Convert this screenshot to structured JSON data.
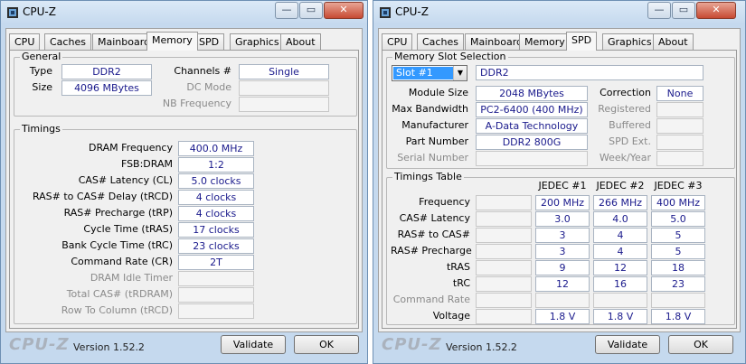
{
  "left_window": {
    "title": "CPU-Z",
    "tabs": [
      "CPU",
      "Caches",
      "Mainboard",
      "Memory",
      "SPD",
      "Graphics",
      "About"
    ],
    "active_tab": "Memory",
    "general": {
      "title": "General",
      "type_label": "Type",
      "type_value": "DDR2",
      "size_label": "Size",
      "size_value": "4096 MBytes",
      "channels_label": "Channels #",
      "channels_value": "Single",
      "dc_mode_label": "DC Mode",
      "nb_frequency_label": "NB Frequency"
    },
    "timings": {
      "title": "Timings",
      "rows": [
        {
          "label": "DRAM Frequency",
          "value": "400.0 MHz"
        },
        {
          "label": "FSB:DRAM",
          "value": "1:2"
        },
        {
          "label": "CAS# Latency (CL)",
          "value": "5.0 clocks"
        },
        {
          "label": "RAS# to CAS# Delay (tRCD)",
          "value": "4 clocks"
        },
        {
          "label": "RAS# Precharge (tRP)",
          "value": "4 clocks"
        },
        {
          "label": "Cycle Time (tRAS)",
          "value": "17 clocks"
        },
        {
          "label": "Bank Cycle Time (tRC)",
          "value": "23 clocks"
        },
        {
          "label": "Command Rate (CR)",
          "value": "2T"
        },
        {
          "label": "DRAM Idle Timer",
          "value": ""
        },
        {
          "label": "Total CAS# (tRDRAM)",
          "value": ""
        },
        {
          "label": "Row To Column (tRCD)",
          "value": ""
        }
      ]
    },
    "footer": {
      "logo": "CPU-Z",
      "version": "Version 1.52.2",
      "validate": "Validate",
      "ok": "OK"
    }
  },
  "right_window": {
    "title": "CPU-Z",
    "tabs": [
      "CPU",
      "Caches",
      "Mainboard",
      "Memory",
      "SPD",
      "Graphics",
      "About"
    ],
    "active_tab": "SPD",
    "slot": {
      "title": "Memory Slot Selection",
      "selected": "Slot #1",
      "type_value": "DDR2",
      "module_size_label": "Module Size",
      "module_size_value": "2048 MBytes",
      "max_bandwidth_label": "Max Bandwidth",
      "max_bandwidth_value": "PC2-6400 (400 MHz)",
      "manufacturer_label": "Manufacturer",
      "manufacturer_value": "A-Data Technology",
      "part_number_label": "Part Number",
      "part_number_value": "DDR2 800G",
      "serial_number_label": "Serial Number",
      "correction_label": "Correction",
      "correction_value": "None",
      "registered_label": "Registered",
      "buffered_label": "Buffered",
      "spd_ext_label": "SPD Ext.",
      "week_year_label": "Week/Year"
    },
    "timings_table": {
      "title": "Timings Table",
      "columns": [
        "JEDEC #1",
        "JEDEC #2",
        "JEDEC #3"
      ],
      "rows": [
        {
          "label": "Frequency",
          "values": [
            "200 MHz",
            "266 MHz",
            "400 MHz"
          ]
        },
        {
          "label": "CAS# Latency",
          "values": [
            "3.0",
            "4.0",
            "5.0"
          ]
        },
        {
          "label": "RAS# to CAS#",
          "values": [
            "3",
            "4",
            "5"
          ]
        },
        {
          "label": "RAS# Precharge",
          "values": [
            "3",
            "4",
            "5"
          ]
        },
        {
          "label": "tRAS",
          "values": [
            "9",
            "12",
            "18"
          ]
        },
        {
          "label": "tRC",
          "values": [
            "12",
            "16",
            "23"
          ]
        },
        {
          "label": "Command Rate",
          "values": [
            "",
            "",
            ""
          ]
        },
        {
          "label": "Voltage",
          "values": [
            "1.8 V",
            "1.8 V",
            "1.8 V"
          ]
        }
      ]
    },
    "footer": {
      "logo": "CPU-Z",
      "version": "Version 1.52.2",
      "validate": "Validate",
      "ok": "OK"
    }
  },
  "colors": {
    "value_text": "#1a1a8c",
    "frame": "#c5d9ee",
    "close_button": "#c74a33"
  },
  "icons": {
    "app": "cpu-z-icon",
    "minimize": "minimize-icon",
    "maximize": "maximize-icon",
    "close": "close-icon",
    "dropdown": "chevron-down-icon"
  }
}
